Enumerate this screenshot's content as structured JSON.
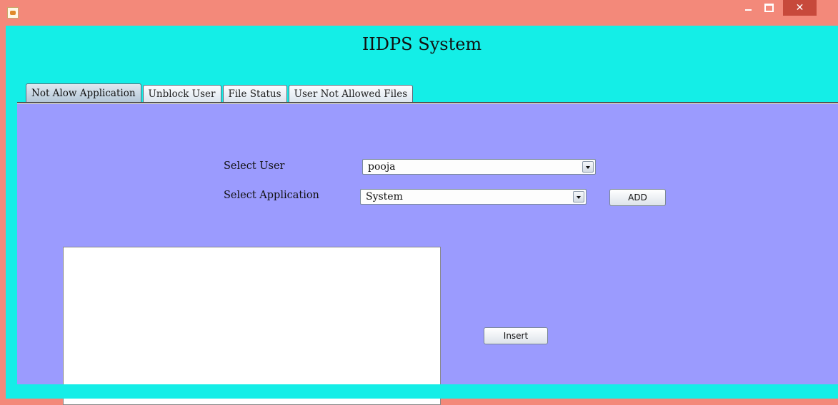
{
  "window": {
    "title": "",
    "close_glyph": "✕"
  },
  "app": {
    "title": "IIDPS System"
  },
  "tabs": [
    {
      "label": "Not Alow Application",
      "active": true
    },
    {
      "label": "Unblock User",
      "active": false
    },
    {
      "label": "File Status",
      "active": false
    },
    {
      "label": "User Not Allowed Files",
      "active": false
    }
  ],
  "form": {
    "select_user_label": "Select User",
    "select_user_value": "pooja",
    "select_application_label": "Select Application",
    "select_application_value": "System",
    "add_button": "ADD",
    "insert_button": "Insert"
  },
  "colors": {
    "titlebar": "#f3897a",
    "client": "#14eee7",
    "panel": "#9b9bfe"
  },
  "icons": [
    "java-app-icon",
    "minimize-icon",
    "maximize-icon",
    "close-icon",
    "dropdown-arrow-icon"
  ]
}
